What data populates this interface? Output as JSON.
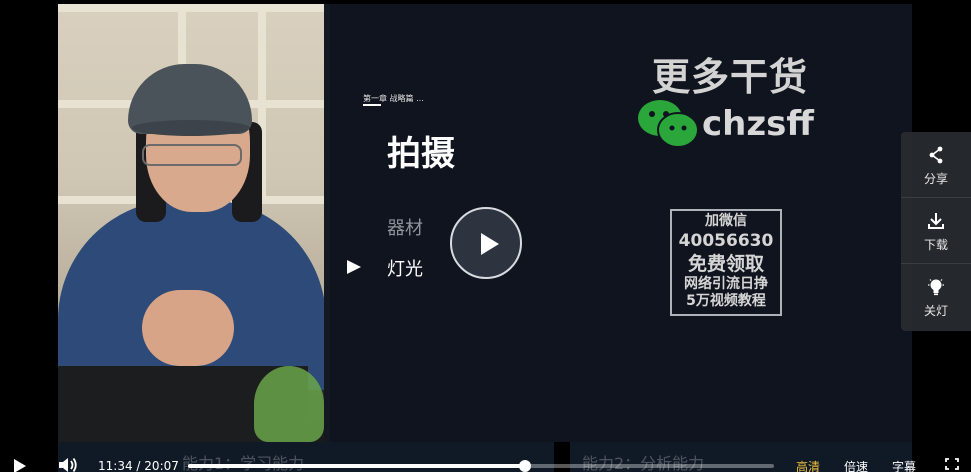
{
  "slide": {
    "chapter": "第一章 战略篇 ...",
    "title": "拍摄",
    "menu": [
      "器材",
      "灯光"
    ]
  },
  "watermark": {
    "headline": "更多干货",
    "wechat_id": "chzsff",
    "box_lines": [
      "加微信",
      "40056630",
      "免费领取",
      "网络引流日挣",
      "5万视频教程"
    ]
  },
  "side_menu": {
    "share": "分享",
    "download": "下载",
    "lights_off": "关灯"
  },
  "controls": {
    "current_time": "11:34",
    "separator": "/",
    "duration": "20:07",
    "progress": 0.575,
    "quality": "高清",
    "speed": "倍速",
    "subtitles": "字幕",
    "chapters": [
      "能力1：学习能力",
      "能力2：分析能力"
    ]
  },
  "colors": {
    "quality_accent": "#f0c040",
    "wechat_green": "#2aa63a"
  }
}
